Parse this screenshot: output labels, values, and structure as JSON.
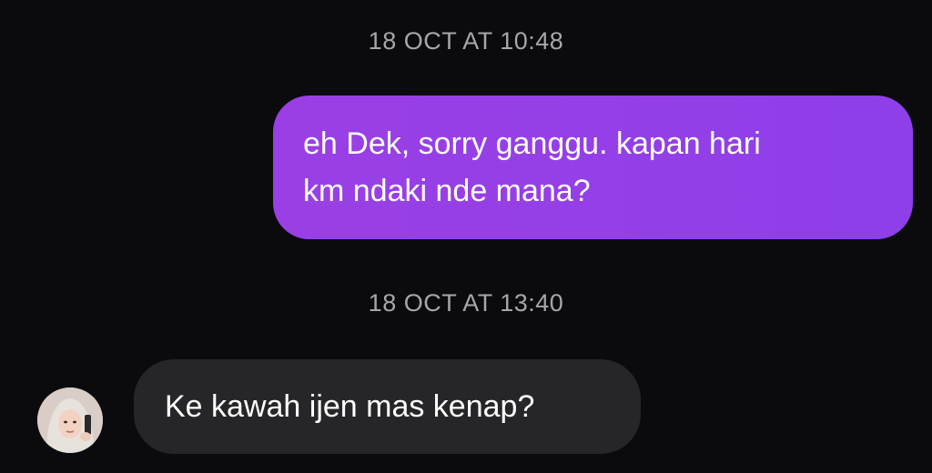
{
  "conversation": {
    "timestamp_1": "18 OCT AT 10:48",
    "outgoing_message": {
      "line_1": "eh Dek, sorry ganggu. kapan hari",
      "line_2": "km ndaki nde mana?"
    },
    "timestamp_2": "18 OCT AT 13:40",
    "incoming_message": {
      "text": "Ke kawah ijen mas kenap?",
      "sender_avatar_icon": "profile-photo-icon"
    }
  },
  "colors": {
    "background": "#0b0b0e",
    "outgoing_bubble": "#9a3fe6",
    "incoming_bubble": "#262629",
    "timestamp_text": "#a6a6ab",
    "message_text": "#ffffff"
  }
}
